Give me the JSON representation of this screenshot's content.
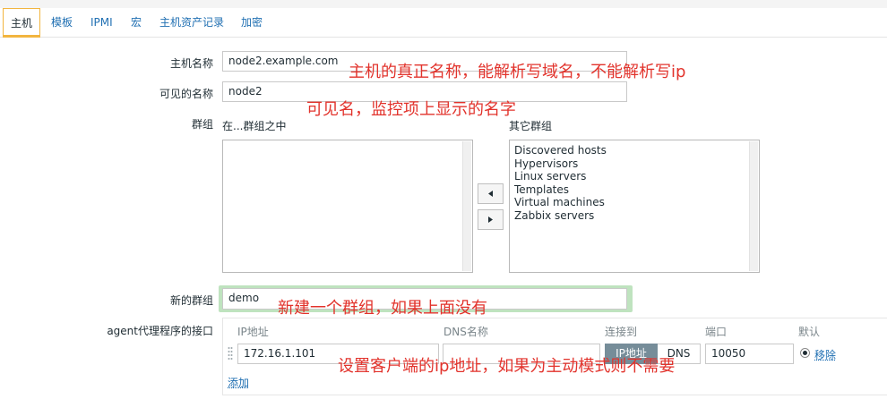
{
  "tabs": [
    {
      "label": "主机",
      "active": true
    },
    {
      "label": "模板"
    },
    {
      "label": "IPMI"
    },
    {
      "label": "宏"
    },
    {
      "label": "主机资产记录"
    },
    {
      "label": "加密"
    }
  ],
  "form": {
    "host_name_label": "主机名称",
    "host_name_value": "node2.example.com",
    "visible_name_label": "可见的名称",
    "visible_name_value": "node2",
    "groups_label": "群组",
    "in_groups_label": "在...群组之中",
    "other_groups_label": "其它群组",
    "other_groups": [
      "Discovered hosts",
      "Hypervisors",
      "Linux servers",
      "Templates",
      "Virtual machines",
      "Zabbix servers"
    ],
    "new_group_label": "新的群组",
    "new_group_value": "demo",
    "agent_interface_label": "agent代理程序的接口"
  },
  "interfaces": {
    "col_ip": "IP地址",
    "col_dns": "DNS名称",
    "col_connect": "连接到",
    "col_port": "端口",
    "col_default": "默认",
    "ip_value": "172.16.1.101",
    "dns_value": "",
    "connect_ip_label": "IP地址",
    "connect_dns_label": "DNS",
    "port_value": "10050",
    "remove_link": "移除",
    "add_link": "添加"
  },
  "annotations": {
    "host_name_note": "主机的真正名称，能解析写域名，不能解析写ip",
    "visible_name_note": "可见名，监控项上显示的名字",
    "new_group_note": "新建一个群组，如果上面没有",
    "agent_note": "设置客户端的ip地址，如果为主动模式则不需要"
  },
  "colors": {
    "link": "#1f6fb2",
    "annotation": "#e2332c",
    "active_tab_accent": "#f2b53f",
    "selected_segment": "#768d99",
    "focus_border": "#b8dfb8"
  }
}
